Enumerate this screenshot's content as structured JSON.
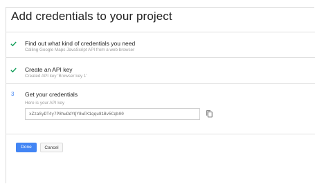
{
  "dialog": {
    "title": "Add credentials to your project"
  },
  "steps": [
    {
      "status": "done",
      "title": "Find out what kind of credentials you need",
      "subtitle": "Calling Google Maps JavaScript API from a web browser"
    },
    {
      "status": "done",
      "title": "Create an API key",
      "subtitle": "Created API key 'Browser key 1'"
    },
    {
      "status": "current",
      "number": "3",
      "title": "Get your credentials",
      "key_label": "Here is your API key",
      "api_key": "xZzaSyDT4y7P8hwDdYQY8wFK1qqu81Bv5Cqb00"
    }
  ],
  "buttons": {
    "done": "Done",
    "cancel": "Cancel"
  },
  "colors": {
    "check": "#0f9d58",
    "accent": "#4285f4"
  },
  "icons": {
    "step_done": "check-icon",
    "copy": "copy-icon"
  }
}
